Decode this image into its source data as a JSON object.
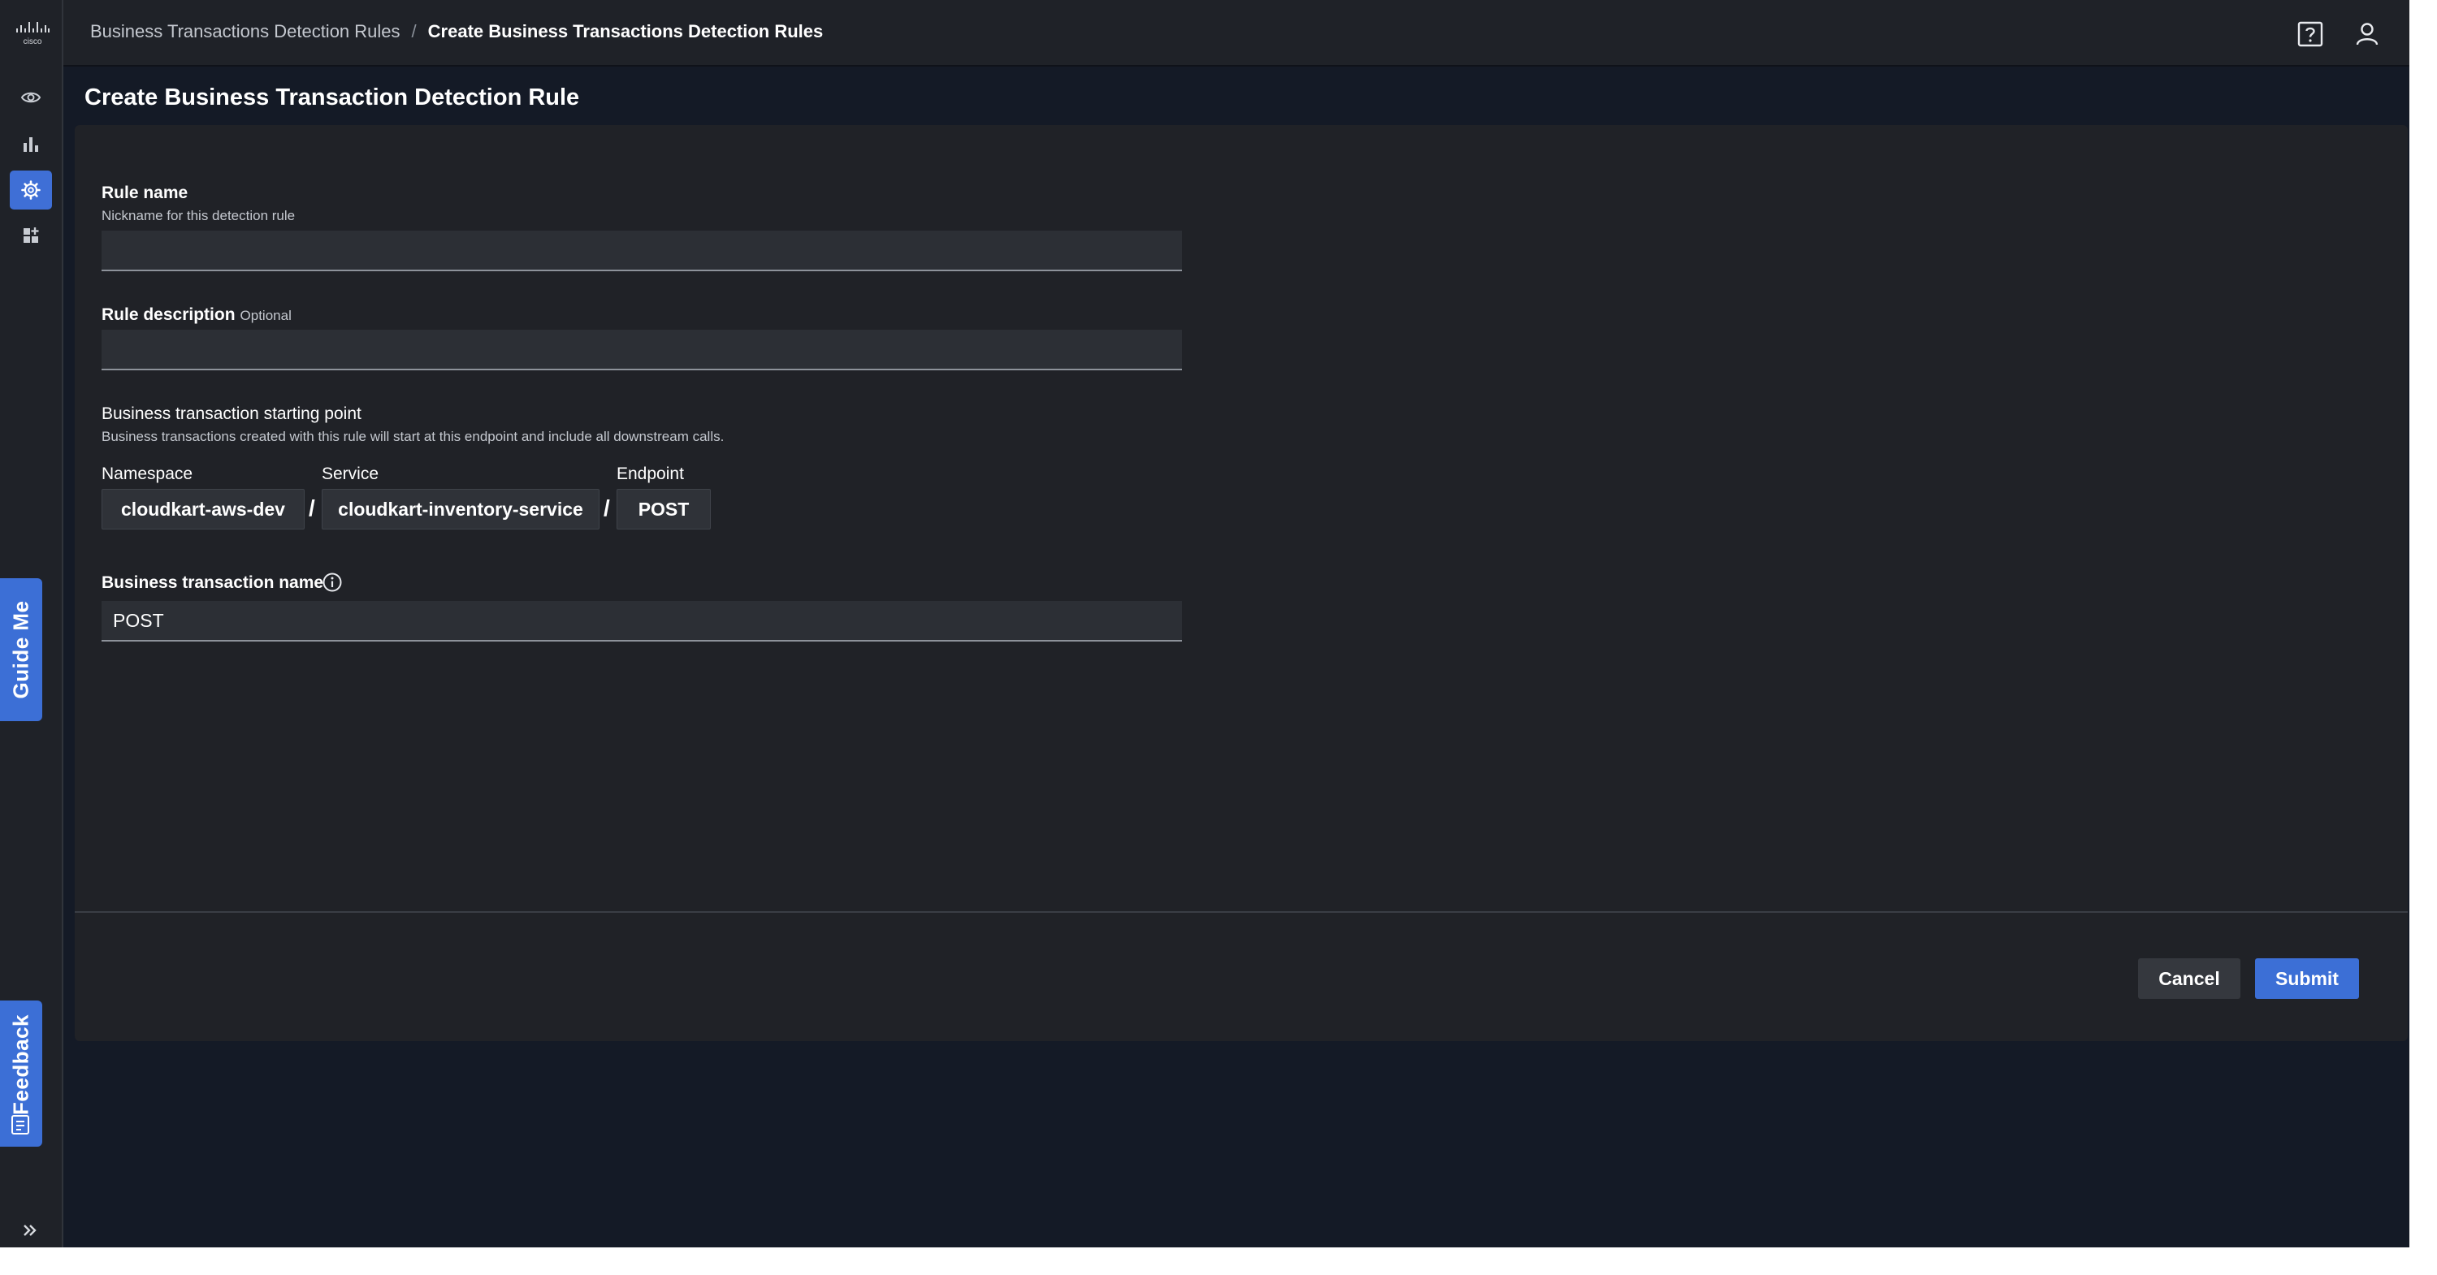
{
  "header": {
    "breadcrumb": [
      {
        "label": "Business Transactions Detection Rules"
      },
      {
        "label": "Create Business Transactions Detection Rules"
      }
    ],
    "separator": "/"
  },
  "page": {
    "title": "Create Business Transaction Detection Rule"
  },
  "form": {
    "rule_name": {
      "label": "Rule name",
      "help": "Nickname for this detection rule",
      "value": ""
    },
    "rule_description": {
      "label": "Rule description",
      "optional": "Optional",
      "value": ""
    },
    "starting_point": {
      "label": "Business transaction starting point",
      "help": "Business transactions created with this rule will start at this endpoint and include all downstream calls.",
      "namespace_label": "Namespace",
      "namespace_value": "cloudkart-aws-dev",
      "service_label": "Service",
      "service_value": "cloudkart-inventory-service",
      "endpoint_label": "Endpoint",
      "endpoint_value": "POST",
      "separator": "/"
    },
    "bt_name": {
      "label": "Business transaction name",
      "value": "POST"
    }
  },
  "actions": {
    "cancel": "Cancel",
    "submit": "Submit"
  },
  "side_tabs": {
    "guide": "Guide Me",
    "feedback": "Feedback"
  },
  "icons": {
    "logo": "cisco-logo-icon",
    "rail": [
      "eye-icon",
      "bar-chart-icon",
      "gear-icon",
      "add-widget-icon"
    ],
    "expand": "double-chevron-right-icon",
    "help": "help-icon",
    "user": "user-icon",
    "info": "info-icon"
  },
  "colors": {
    "accent": "#3c6fd6",
    "background": "#141a26",
    "panel": "#202227"
  }
}
